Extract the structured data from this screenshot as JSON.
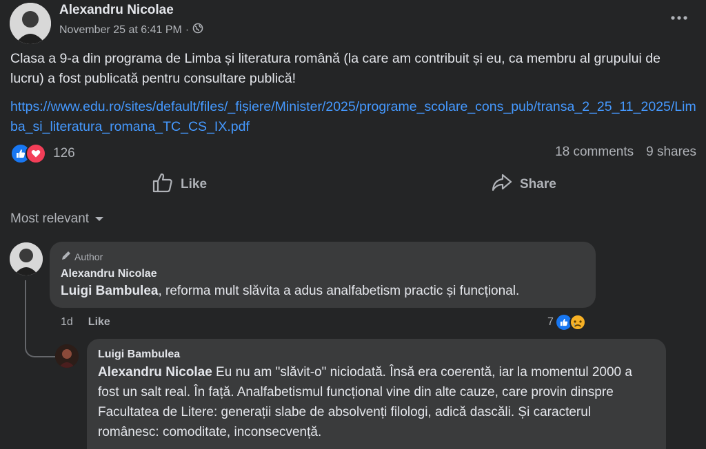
{
  "post": {
    "author": "Alexandru Nicolae",
    "timestamp": "November 25 at 6:41 PM",
    "separator": "·",
    "text": "Clasa a 9-a din programa de Limba și literatura română (la care am contribuit și eu, ca membru al grupului de lucru) a fost publicată pentru consultare publică!",
    "link": "https://www.edu.ro/sites/default/files/_fișiere/Minister/2025/programe_scolare_cons_pub/transa_2_25_11_2025/Limba_si_literatura_romana_TC_CS_IX.pdf"
  },
  "reactions": {
    "count": "126",
    "comments": "18 comments",
    "shares": "9 shares",
    "icons": [
      "like-icon",
      "love-icon"
    ],
    "colors": {
      "like": "#1877f2",
      "love": "#f33e58"
    }
  },
  "actions": {
    "like": "Like",
    "share": "Share"
  },
  "sort": {
    "label": "Most relevant"
  },
  "comments": [
    {
      "badge": "Author",
      "author": "Alexandru Nicolae",
      "mention": "Luigi Bambulea",
      "text": ", reforma mult slăvita a adus analfabetism practic și funcțional.",
      "time": "1d",
      "like": "Like",
      "reaction_count": "7"
    },
    {
      "author": "Luigi Bambulea",
      "mention": "Alexandru Nicolae",
      "text": " Eu nu am \"slăvit-o\" niciodată. Însă era coerentă, iar la momentul 2000 a fost un salt real. În față. Analfabetismul funcțional vine din alte cauze, care provin dinspre Facultatea de Litere: generații slabe de absolvenți filologi, adică dascăli. Și caracterul românesc: comoditate, inconsecvență."
    }
  ]
}
